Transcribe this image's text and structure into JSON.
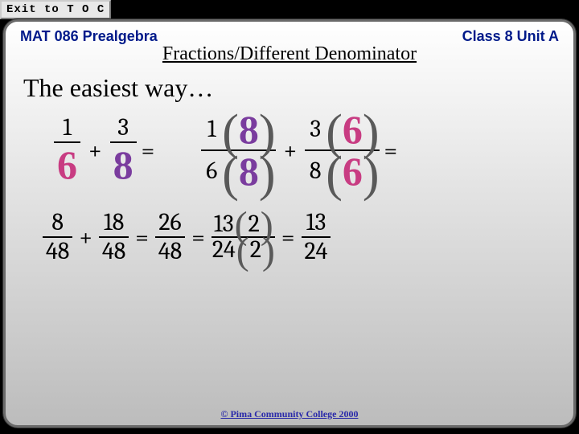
{
  "exit_label": "Exit to T O C",
  "header": {
    "left": "MAT 086  Prealgebra",
    "right": "Class 8  Unit A"
  },
  "subtitle": "Fractions/Different Denominator",
  "lead": "The easiest way…",
  "row1": {
    "fA_n": "1",
    "fA_d": "6",
    "plus": "+",
    "fB_n": "3",
    "fB_d": "8",
    "eq": "=",
    "RA_tn": "1",
    "RA_tm": "8",
    "RA_bn": "6",
    "RA_bm": "8",
    "RB_tn": "3",
    "RB_tm": "6",
    "RB_bn": "8",
    "RB_bm": "6"
  },
  "row2": {
    "a_n": "8",
    "a_d": "48",
    "plus": "+",
    "b_n": "18",
    "b_d": "48",
    "eq": "=",
    "c_n": "26",
    "c_d": "48",
    "d_n1": "13",
    "d_nP": "2",
    "d_d1": "24",
    "d_dP": "2",
    "e_n": "13",
    "e_d": "24"
  },
  "copyright": "© Pima Community College 2000"
}
